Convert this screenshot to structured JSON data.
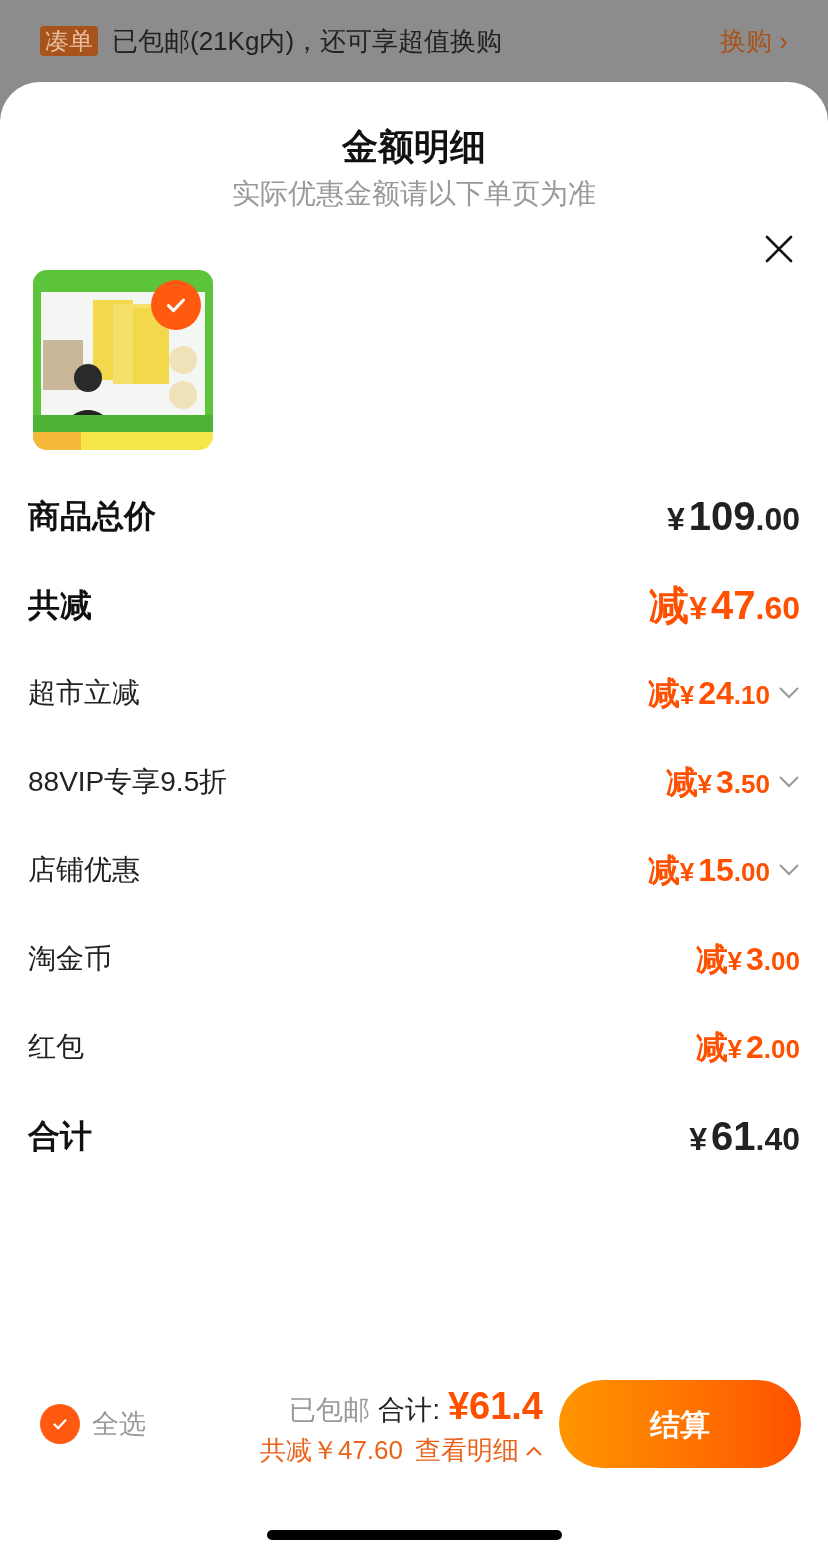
{
  "top_bar": {
    "tag": "凑单",
    "text": "已包邮(21Kg内)，还可享超值换购",
    "link": "换购 ›"
  },
  "sheet": {
    "title": "金额明细",
    "subtitle": "实际优惠金额请以下单页为准"
  },
  "product": {
    "kind": "picture",
    "selected": true
  },
  "rows": [
    {
      "kind": "total",
      "label": "商品总价",
      "sign": "",
      "currency": "¥",
      "main": "109",
      "cents": ".00",
      "expandable": false
    },
    {
      "kind": "reduction",
      "label": "共减",
      "sign": "减",
      "currency": "¥",
      "main": "47",
      "cents": ".60",
      "expandable": false
    },
    {
      "kind": "item",
      "label": "超市立减",
      "sign": "减",
      "currency": "¥",
      "main": "24",
      "cents": ".10",
      "expandable": true
    },
    {
      "kind": "item",
      "label": "88VIP专享9.5折",
      "sign": "减",
      "currency": "¥",
      "main": "3",
      "cents": ".50",
      "expandable": true
    },
    {
      "kind": "item",
      "label": "店铺优惠",
      "sign": "减",
      "currency": "¥",
      "main": "15",
      "cents": ".00",
      "expandable": true
    },
    {
      "kind": "item",
      "label": "淘金币",
      "sign": "减",
      "currency": "¥",
      "main": "3",
      "cents": ".00",
      "expandable": false
    },
    {
      "kind": "item",
      "label": "红包",
      "sign": "减",
      "currency": "¥",
      "main": "2",
      "cents": ".00",
      "expandable": false
    },
    {
      "kind": "total",
      "label": "合计",
      "sign": "",
      "currency": "¥",
      "main": "61",
      "cents": ".40",
      "expandable": false
    }
  ],
  "bottom_bar": {
    "select_all": {
      "label": "全选",
      "checked": true
    },
    "shipping": "已包邮",
    "total_label": "合计:",
    "total": "¥61.4",
    "reduction": "共减￥47.60",
    "details_link": "查看明细",
    "checkout": "结算"
  }
}
